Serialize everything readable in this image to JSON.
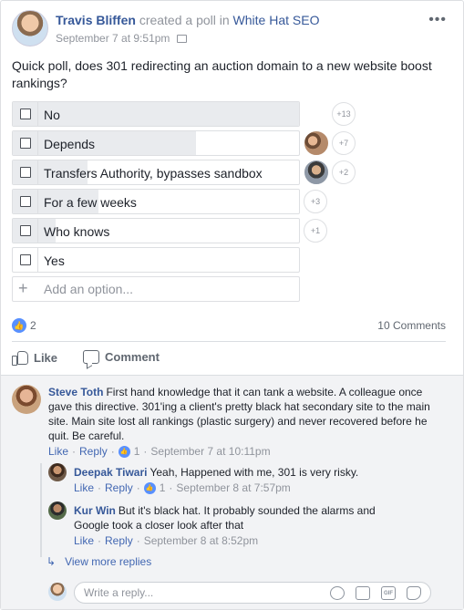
{
  "post": {
    "author": "Travis Bliffen",
    "action": "created a poll in",
    "group": "White Hat SEO",
    "timestamp": "September 7 at 9:51pm",
    "more_label": "•••",
    "question": "Quick poll, does 301 redirecting an auction domain to a new website boost rankings?"
  },
  "poll": {
    "options": [
      {
        "label": "No",
        "votes": 13,
        "badge": "+13"
      },
      {
        "label": "Depends",
        "votes": 7,
        "badge": "+7"
      },
      {
        "label": "Transfers Authority, bypasses sandbox",
        "votes": 2,
        "badge": "+2"
      },
      {
        "label": "For a few weeks",
        "votes": 3,
        "badge": "+3"
      },
      {
        "label": "Who knows",
        "votes": 1,
        "badge": "+1"
      },
      {
        "label": "Yes",
        "votes": 0,
        "badge": ""
      }
    ],
    "add_placeholder": "Add an option..."
  },
  "stats": {
    "likes": "2",
    "comments": "10 Comments"
  },
  "actions": {
    "like": "Like",
    "comment": "Comment"
  },
  "comments": [
    {
      "name": "Steve Toth",
      "text": "First hand knowledge that it can tank a website. A colleague once gave this directive. 301'ing a client's pretty black hat secondary site to the main site. Main site lost all rankings (plastic surgery) and never recovered before he quit. Be careful.",
      "like": "Like",
      "reply": "Reply",
      "reactions": "1",
      "time": "September 7 at 10:11pm"
    }
  ],
  "replies": [
    {
      "name": "Deepak Tiwari",
      "text": "Yeah, Happened with me, 301 is very risky.",
      "like": "Like",
      "reply": "Reply",
      "reactions": "1",
      "time": "September 8 at 7:57pm"
    },
    {
      "name": "Kur Win",
      "text": "But it's black hat. It probably sounded the alarms and Google took a closer look after that",
      "like": "Like",
      "reply": "Reply",
      "time": "September 8 at 8:52pm"
    }
  ],
  "view_more": "View more replies",
  "reply_box": {
    "placeholder": "Write a reply...",
    "gif_label": "GIF"
  },
  "colors": {
    "link": "#365899",
    "like_blue": "#5890ff",
    "muted": "#90949c"
  }
}
